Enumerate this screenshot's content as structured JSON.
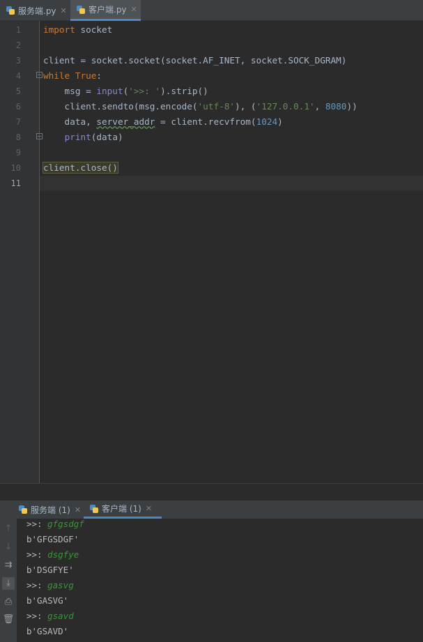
{
  "editor_tabs": [
    {
      "label": "服务端.py",
      "active": false
    },
    {
      "label": "客户端.py",
      "active": true
    }
  ],
  "line_numbers": [
    "1",
    "2",
    "3",
    "4",
    "5",
    "6",
    "7",
    "8",
    "9",
    "10",
    "11"
  ],
  "code": {
    "l1": {
      "kw": "import",
      "rest": " socket"
    },
    "l3": {
      "text": "client = socket.socket(socket.AF_INET, socket.SOCK_DGRAM)"
    },
    "l4": {
      "kw": "while",
      "sp": " ",
      "kw2": "True",
      "rest": ":"
    },
    "l5": {
      "a": "    msg = ",
      "fn": "input",
      "b": "(",
      "str": "'>>: '",
      "c": ").strip()"
    },
    "l6": {
      "a": "    client.sendto(msg.encode(",
      "s1": "'utf-8'",
      "b": "), (",
      "s2": "'127.0.0.1'",
      "c": ", ",
      "num": "8080",
      "d": "))"
    },
    "l7": {
      "a": "    data, ",
      "warn": "server_addr",
      "b": " = client.recvfrom(",
      "num": "1024",
      "c": ")"
    },
    "l8": {
      "a": "    ",
      "fn": "print",
      "b": "(data)"
    },
    "l10": {
      "text": "client.close()"
    }
  },
  "run_tabs": [
    {
      "label": "服务端 (1)",
      "active": false
    },
    {
      "label": "客户端 (1)",
      "active": true
    }
  ],
  "console": [
    {
      "prompt": ">>: ",
      "input": "gfgsdgf"
    },
    {
      "out": "b'GFGSDGF'"
    },
    {
      "prompt": ">>: ",
      "input": "dsgfye"
    },
    {
      "out": "b'DSGFYE'"
    },
    {
      "prompt": ">>: ",
      "input": "gasvg"
    },
    {
      "out": "b'GASVG'"
    },
    {
      "prompt": ">>: ",
      "input": "gsavd"
    },
    {
      "out": "b'GSAVD'"
    }
  ],
  "icons": [
    "python-file-icon",
    "close-icon",
    "up-arrow-icon",
    "down-arrow-icon",
    "soft-wrap-icon",
    "scroll-to-end-icon",
    "print-icon",
    "trash-icon",
    "fold-icon"
  ],
  "colors": {
    "keyword": "#cc7832",
    "string": "#6a8759",
    "number": "#6897bb",
    "builtin": "#8888c6",
    "console_input": "#2e9c2e",
    "accent": "#4a88c7"
  }
}
